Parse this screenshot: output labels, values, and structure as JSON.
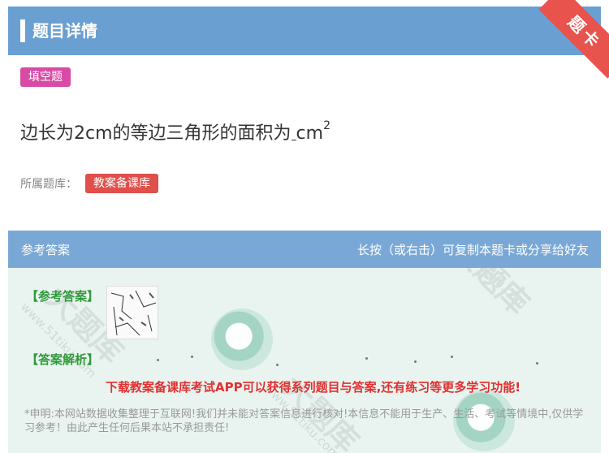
{
  "header": {
    "title": "题目详情"
  },
  "corner_badge": "题卡",
  "question": {
    "type_tag": "填空题",
    "text": "边长为2cm的等边三角形的面积为",
    "unit": "cm",
    "unit_power": "2"
  },
  "source": {
    "label": "所属题库：",
    "tag": "教案备课库"
  },
  "answer_section": {
    "title": "参考答案",
    "hint": "长按（或右击）可复制本题卡或分享给好友",
    "answer_label": "【参考答案】",
    "analysis_label": "【答案解析】",
    "promo": "下载教案备课库考试APP可以获得系列题目与答案,还有练习等更多学习功能!",
    "disclaimer": "*申明:本网站数据收集整理于互联网!我们并未能对答案信息进行核对!本信息不能用于生产、生活、考试等情境中,仅供学习参考！由此产生任何后果本站不承担责任!"
  },
  "watermark": {
    "site": "www.51tiku.com",
    "brand": "大题库"
  },
  "colors": {
    "header": "#6a9fd1",
    "answer_header": "#7aa8d6",
    "type_tag": "#d94aa6",
    "source_tag": "#e04f4a",
    "answer_body": "#e9f4f0",
    "label_green": "#2f9a3a",
    "promo_red": "#e23030"
  }
}
